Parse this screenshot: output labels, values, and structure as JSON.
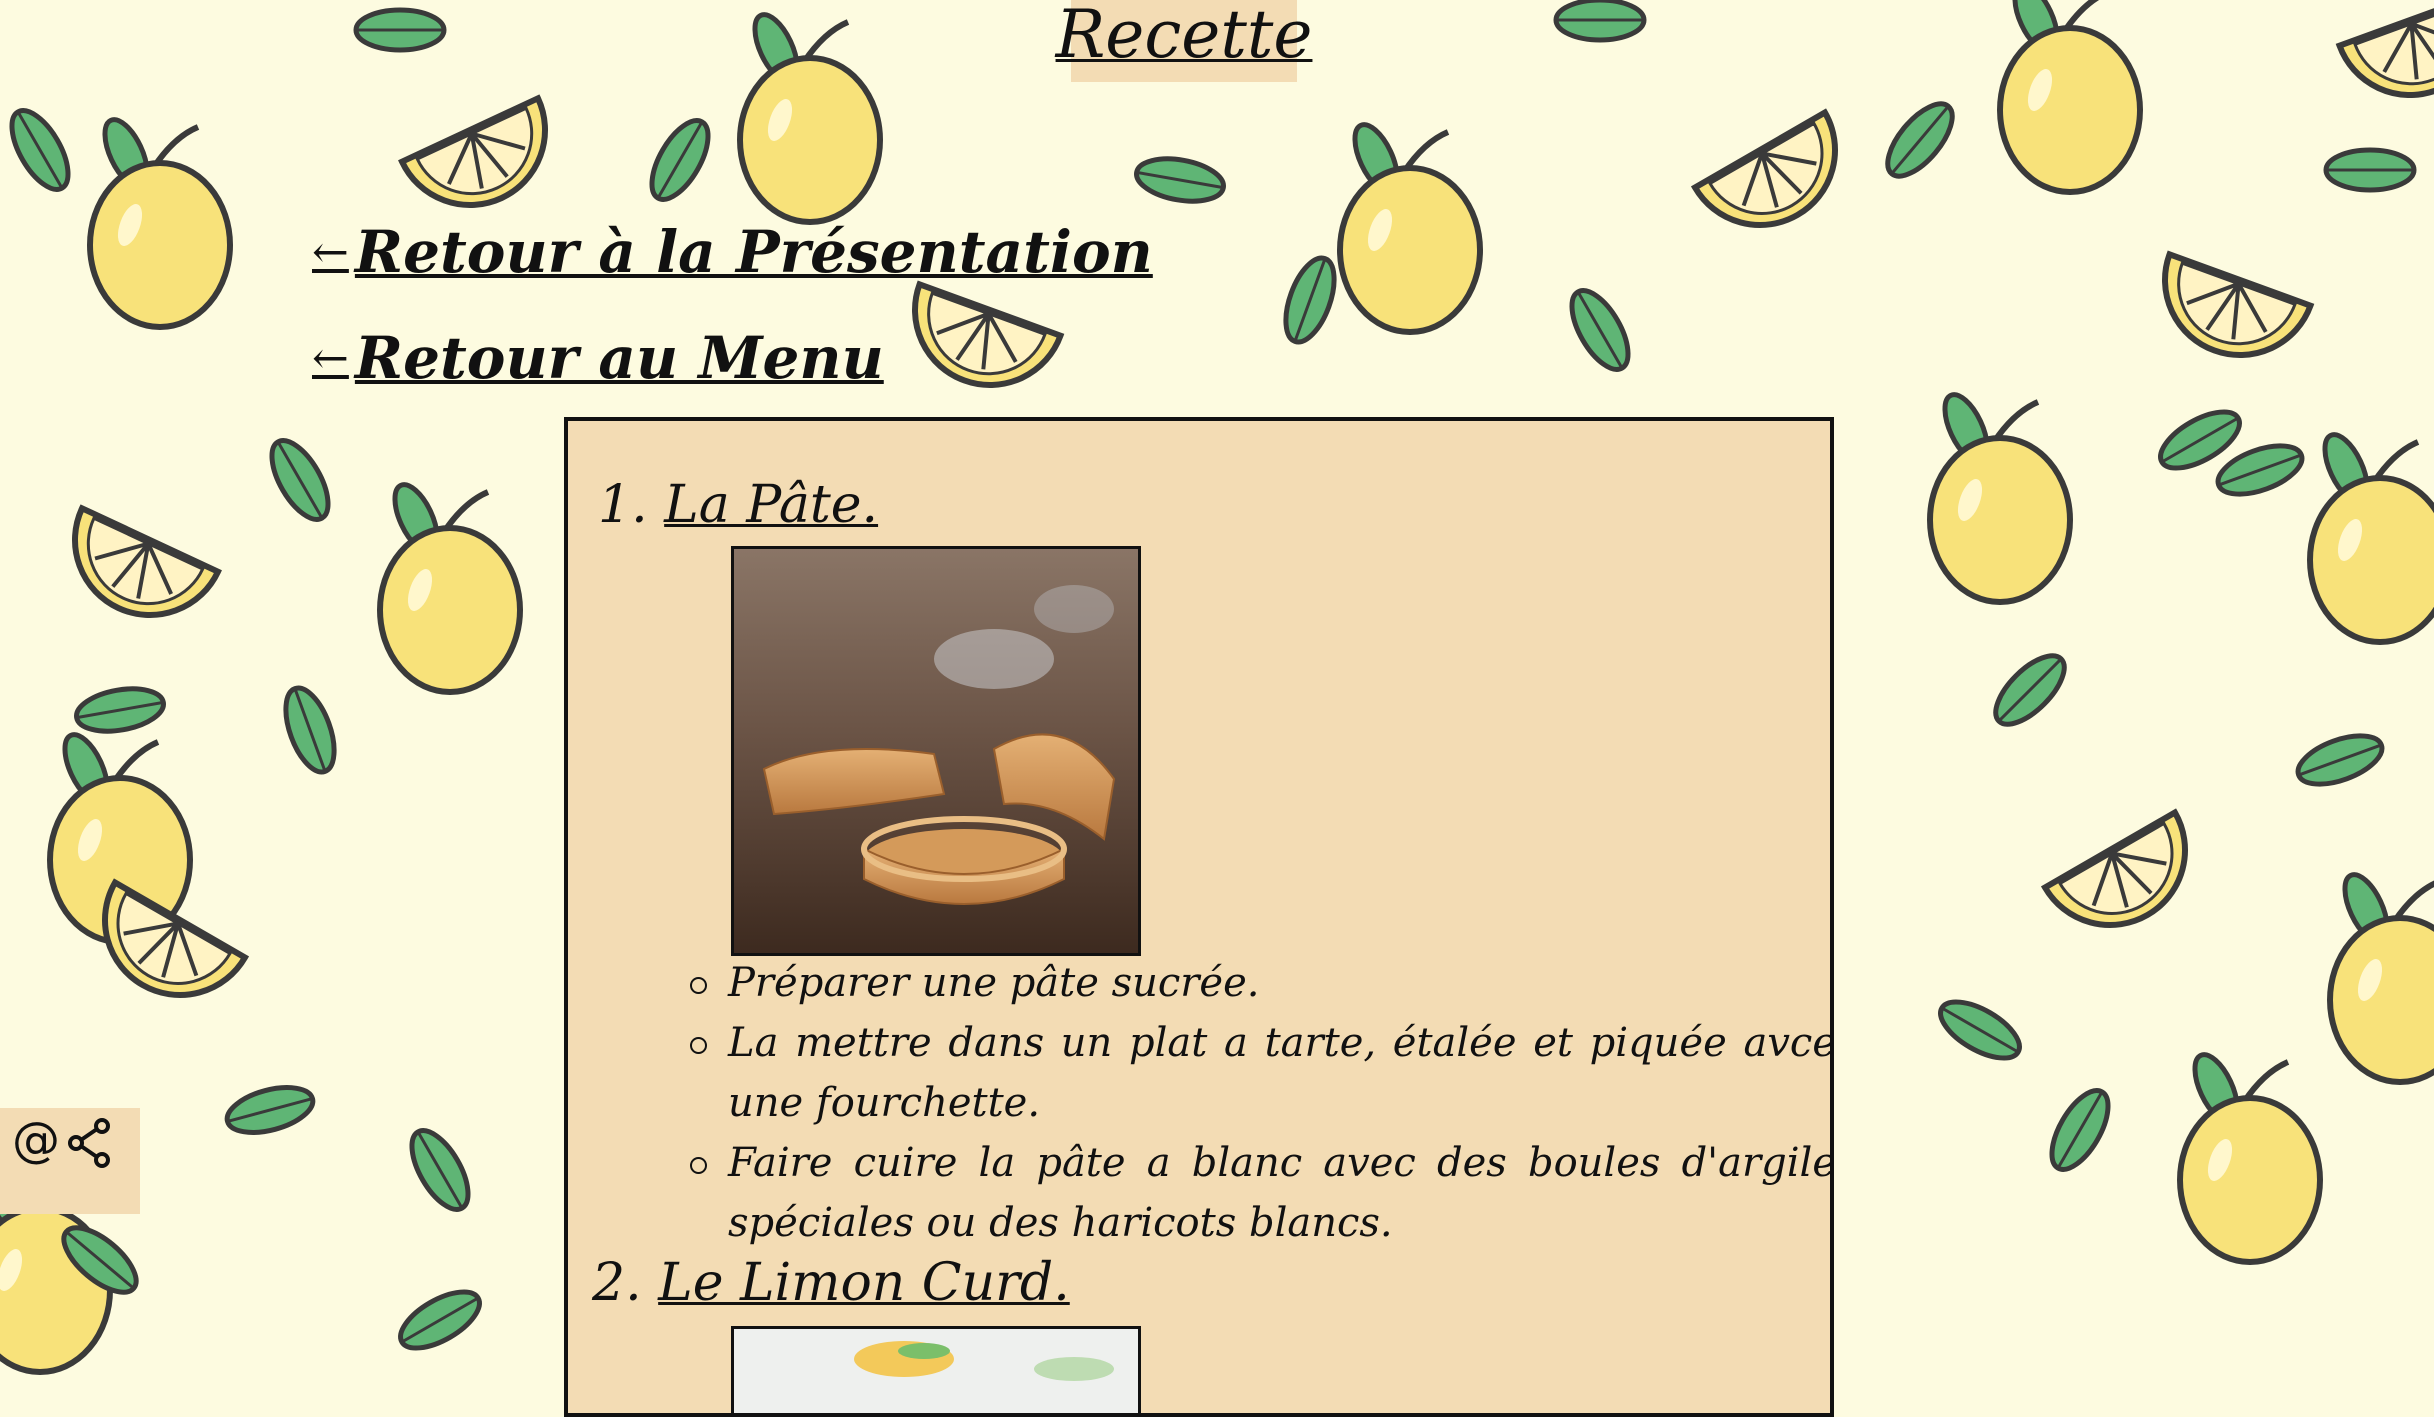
{
  "page": {
    "title": "Recette"
  },
  "nav": {
    "presentation_link": "Retour à la Présentation",
    "menu_link": "Retour au Menu",
    "arrow": "←"
  },
  "share": {
    "at_symbol": "@",
    "email_icon": "at-sign-icon",
    "share_icon": "share-icon"
  },
  "recipe": {
    "sections": [
      {
        "number": "1.",
        "title": "La Pâte.",
        "image": "tart-shells-photo",
        "steps": [
          "Préparer une pâte sucrée.",
          "La mettre dans un plat a tarte, étalée et piquée avce une fourchette.",
          "Faire cuire la pâte a blanc avec des boules d'argile spéciales ou des haricots blancs."
        ]
      },
      {
        "number": "2.",
        "title": "Le Limon Curd.",
        "image": "lemon-curd-photo"
      }
    ]
  },
  "colors": {
    "background": "#fdfbe0",
    "panel": "#f3dcb4",
    "lemon": "#f8e27a",
    "leaf": "#5fb575",
    "outline": "#3a3a3a"
  }
}
